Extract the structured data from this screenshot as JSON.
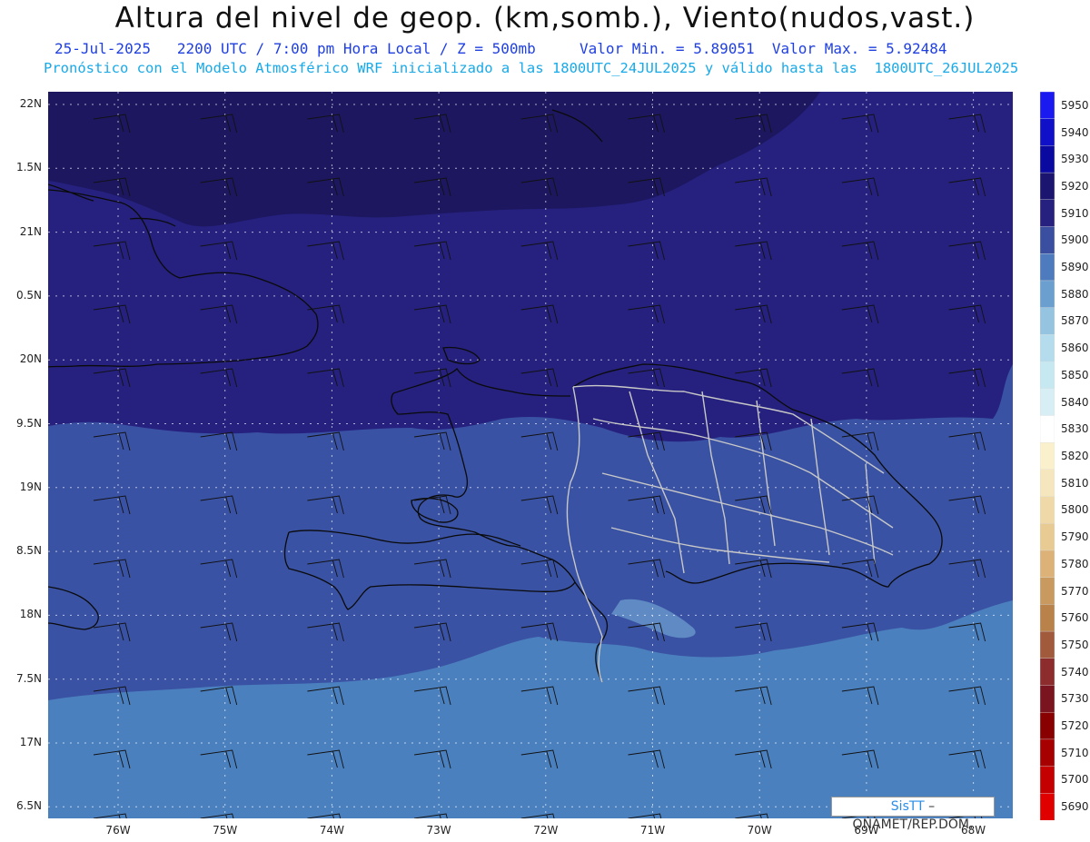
{
  "title": "Altura del nivel de geop. (km,somb.), Viento(nudos,vast.)",
  "subtitle_line1": "25-Jul-2025   2200 UTC / 7:00 pm Hora Local / Z = 500mb     Valor Min. = 5.89051  Valor Max. = 5.92484",
  "subtitle_line2": "Pronóstico con el Modelo Atmosférico WRF inicializado a las 1800UTC_24JUL2025 y válido hasta las  1800UTC_26JUL2025",
  "credit": {
    "brand": "SisTT",
    "text": " – ONAMET/REP.DOM."
  },
  "lat_labels": [
    "22N",
    "1.5N",
    "21N",
    "0.5N",
    "20N",
    "9.5N",
    "19N",
    "8.5N",
    "18N",
    "7.5N",
    "17N",
    "6.5N"
  ],
  "lon_labels": [
    "76W",
    "75W",
    "74W",
    "73W",
    "72W",
    "71W",
    "70W",
    "69W",
    "68W"
  ],
  "colorbar": {
    "labels": [
      "5950",
      "5940",
      "5930",
      "5920",
      "5910",
      "5900",
      "5890",
      "5880",
      "5870",
      "5860",
      "5850",
      "5840",
      "5830",
      "5820",
      "5810",
      "5800",
      "5790",
      "5780",
      "5770",
      "5760",
      "5750",
      "5740",
      "5730",
      "5720",
      "5710",
      "5700",
      "5690"
    ],
    "colors": [
      "#1a1af0",
      "#1010c8",
      "#0a0aa0",
      "#1b1570",
      "#26207e",
      "#3a4fa0",
      "#4d7bbd",
      "#6a9fcf",
      "#95c4e0",
      "#b4dcec",
      "#c6e8f1",
      "#d7eef5",
      "#ffffff",
      "#fbf0cc",
      "#f6e6be",
      "#f0d9a9",
      "#e8ca93",
      "#dcb278",
      "#c99a5f",
      "#b8824a",
      "#a15a3c",
      "#8c2c2c",
      "#7a141e",
      "#880000",
      "#a60000",
      "#c40000",
      "#e00000"
    ]
  },
  "colors": {
    "zone_dark": "#1d1760",
    "zone_mid": "#26217e",
    "zone_blue": "#3a52a3",
    "zone_light": "#4b80bf",
    "zone_pale": "#6fa3d2",
    "coast": "#0a0a0a",
    "borders": "#c8c8c8"
  }
}
